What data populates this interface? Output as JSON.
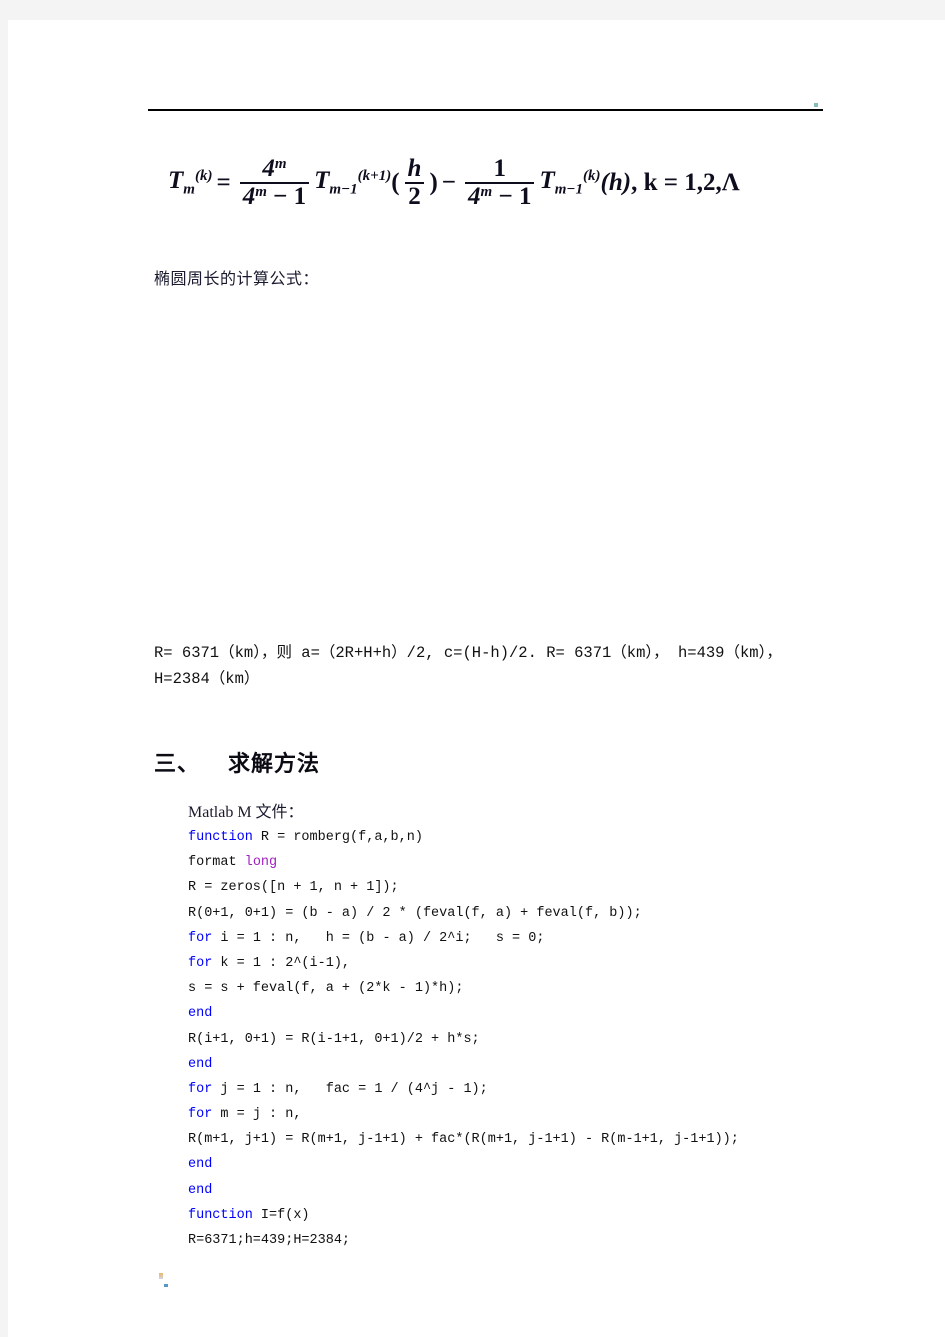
{
  "document": {
    "header_rule": "horizontal-rule",
    "formula": {
      "label": "romberg-extrapolation-formula",
      "lhs_base": "T",
      "lhs_sub": "m",
      "lhs_sup": "(k)",
      "equals": "=",
      "term1_num": "4",
      "term1_num_sup": "m",
      "term1_den": "4",
      "term1_den_sup": "m",
      "term1_den_rest": " − 1",
      "term1_T": "T",
      "term1_T_sub": "m−1",
      "term1_T_sup": "(k+1)",
      "term1_arg_open": "(",
      "term1_arg_num": "h",
      "term1_arg_den": "2",
      "term1_arg_close": ")",
      "minus": "−",
      "term2_num": "1",
      "term2_den": "4",
      "term2_den_sup": "m",
      "term2_den_rest": " − 1",
      "term2_T": "T",
      "term2_T_sub": "m−1",
      "term2_T_sup": "(k)",
      "term2_arg": "(h)",
      "tail": ", k = 1,2,Λ",
      "plain_text": "T_m^(k) = 4^m/(4^m−1) T_{m−1}^(k+1)(h/2) − 1/(4^m−1) T_{m−1}^(k)(h) , k = 1,2,Λ"
    },
    "ellipse_caption": "椭圆周长的计算公式：",
    "figure_placeholder": "",
    "params": {
      "line1": "R= 6371（km），则 a=（2R+H+h）/2, c=(H-h)/2. R= 6371（km），  h=439（km），",
      "line2": "H=2384（km）"
    },
    "section": {
      "number": "三、",
      "title": "求解方法"
    },
    "code_intro": "Matlab M 文件：",
    "code_lines": [
      {
        "segments": [
          {
            "t": "function",
            "c": "kw"
          },
          {
            "t": " R = romberg(f,a,b,n)",
            "c": ""
          }
        ]
      },
      {
        "segments": [
          {
            "t": "format ",
            "c": ""
          },
          {
            "t": "long",
            "c": "str"
          }
        ]
      },
      {
        "segments": [
          {
            "t": "R = zeros([n + 1, n + 1]);",
            "c": ""
          }
        ]
      },
      {
        "segments": [
          {
            "t": "R(0+1, 0+1) = (b - a) / 2 * (feval(f, a) + feval(f, b));",
            "c": ""
          }
        ]
      },
      {
        "segments": [
          {
            "t": "for",
            "c": "kw"
          },
          {
            "t": " i = 1 : n,   h = (b - a) / 2^i;   s = 0;",
            "c": ""
          }
        ]
      },
      {
        "segments": [
          {
            "t": "for",
            "c": "kw"
          },
          {
            "t": " k = 1 : 2^(i-1),",
            "c": ""
          }
        ]
      },
      {
        "segments": [
          {
            "t": "s = s + feval(f, a + (2*k - 1)*h);",
            "c": ""
          }
        ]
      },
      {
        "segments": [
          {
            "t": "end",
            "c": "kw"
          }
        ]
      },
      {
        "segments": [
          {
            "t": "R(i+1, 0+1) = R(i-1+1, 0+1)/2 + h*s;",
            "c": ""
          }
        ]
      },
      {
        "segments": [
          {
            "t": "end",
            "c": "kw"
          }
        ]
      },
      {
        "segments": [
          {
            "t": "for",
            "c": "kw"
          },
          {
            "t": " j = 1 : n,   fac = 1 / (4^j - 1);",
            "c": ""
          }
        ]
      },
      {
        "segments": [
          {
            "t": "for",
            "c": "kw"
          },
          {
            "t": " m = j : n,",
            "c": ""
          }
        ]
      },
      {
        "segments": [
          {
            "t": "R(m+1, j+1) = R(m+1, j-1+1) + fac*(R(m+1, j-1+1) - R(m-1+1, j-1+1));",
            "c": ""
          }
        ]
      },
      {
        "segments": [
          {
            "t": "end",
            "c": "kw"
          }
        ]
      },
      {
        "segments": [
          {
            "t": "end",
            "c": "kw"
          }
        ]
      },
      {
        "segments": [
          {
            "t": "function",
            "c": "kw"
          },
          {
            "t": " I=f(x)",
            "c": ""
          }
        ]
      },
      {
        "segments": [
          {
            "t": "R=6371;h=439;H=2384;",
            "c": ""
          }
        ]
      }
    ]
  },
  "colors": {
    "page_background": "#ffffff",
    "outside_background": "#f4f4f4",
    "text": "#111111",
    "keyword_blue": "#0000ff",
    "string_purple": "#a020c0",
    "rule": "#000000"
  }
}
